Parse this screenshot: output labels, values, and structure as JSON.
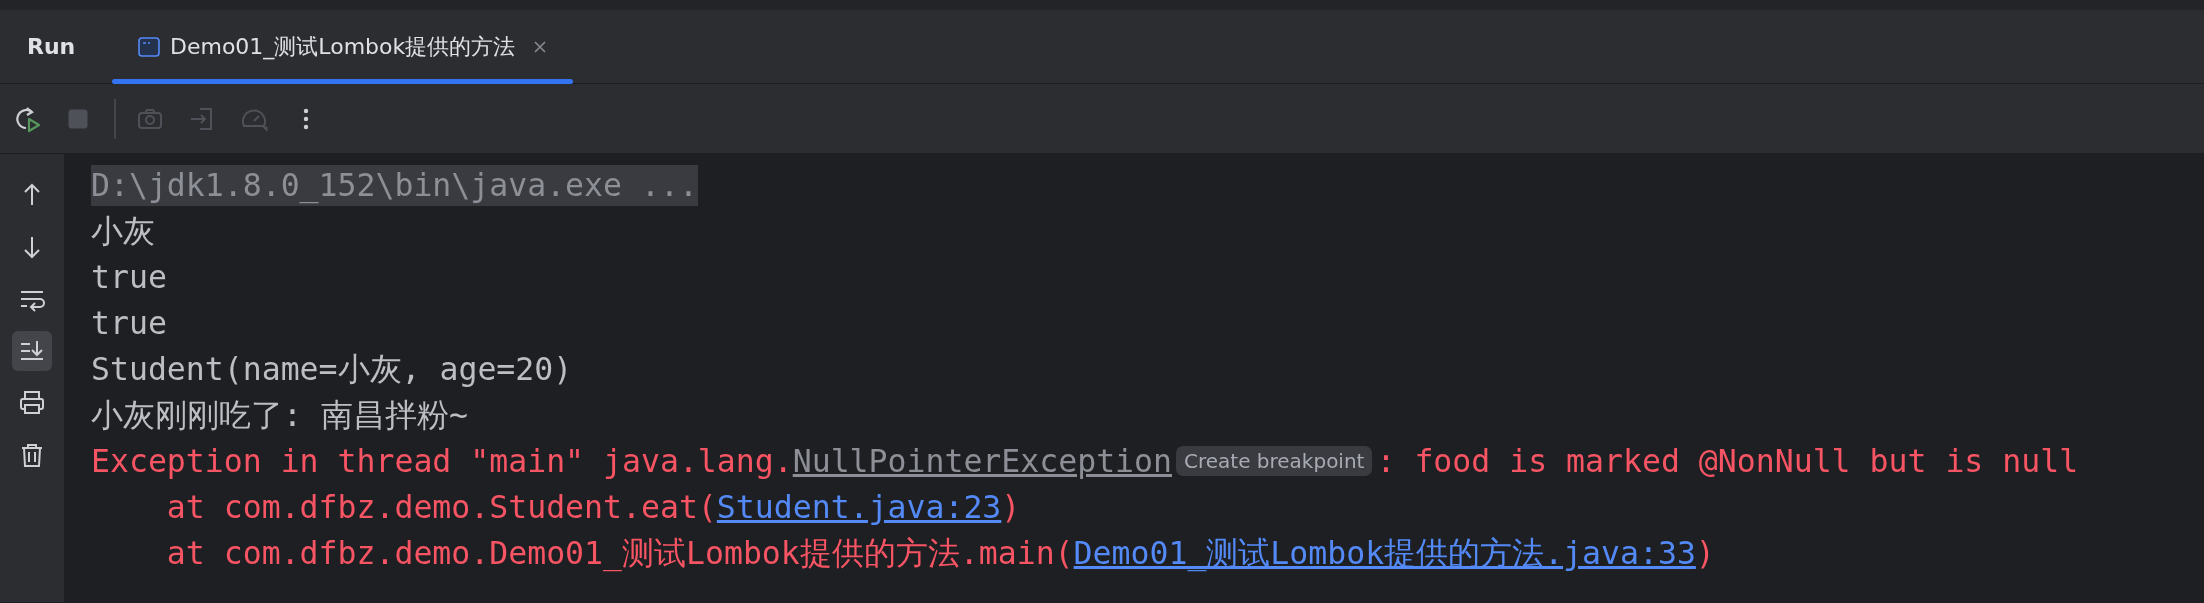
{
  "tool_window": {
    "title": "Run"
  },
  "tabs": [
    {
      "label": "Demo01_测试Lombok提供的方法",
      "selected": true,
      "closable": true
    }
  ],
  "toolbar": {
    "primary": [
      {
        "kind": "rerun",
        "disabled": false
      },
      {
        "kind": "stop",
        "disabled": true
      }
    ],
    "secondary": [
      {
        "kind": "screenshot",
        "disabled": true
      },
      {
        "kind": "attach",
        "disabled": true
      },
      {
        "kind": "profiler",
        "disabled": true
      },
      {
        "kind": "more",
        "disabled": false
      }
    ]
  },
  "gutter": [
    {
      "kind": "up",
      "selected": false
    },
    {
      "kind": "down",
      "selected": false
    },
    {
      "kind": "soft-wrap",
      "selected": false
    },
    {
      "kind": "scroll-end",
      "selected": true
    },
    {
      "kind": "print",
      "selected": false
    },
    {
      "kind": "clear",
      "selected": false
    }
  ],
  "console": [
    {
      "kind": "system",
      "segments": [
        {
          "kind": "text",
          "text": "D:\\jdk1.8.0_152\\bin\\java.exe ..."
        }
      ]
    },
    {
      "kind": "out",
      "segments": [
        {
          "kind": "text",
          "text": "小灰"
        }
      ]
    },
    {
      "kind": "out",
      "segments": [
        {
          "kind": "text",
          "text": "true"
        }
      ]
    },
    {
      "kind": "out",
      "segments": [
        {
          "kind": "text",
          "text": "true"
        }
      ]
    },
    {
      "kind": "out",
      "segments": [
        {
          "kind": "text",
          "text": "Student(name=小灰, age=20)"
        }
      ]
    },
    {
      "kind": "out",
      "segments": [
        {
          "kind": "text",
          "text": "小灰刚刚吃了: 南昌拌粉~"
        }
      ]
    },
    {
      "kind": "err",
      "segments": [
        {
          "kind": "text",
          "text": "Exception in thread \"main\" java.lang."
        },
        {
          "kind": "class-link",
          "text": "NullPointerException"
        },
        {
          "kind": "hint",
          "text": "Create breakpoint"
        },
        {
          "kind": "text",
          "text": ": food is marked @NonNull but is null"
        }
      ]
    },
    {
      "kind": "err",
      "segments": [
        {
          "kind": "text",
          "text": "    at com.dfbz.demo.Student.eat("
        },
        {
          "kind": "link",
          "text": "Student.java:23"
        },
        {
          "kind": "text",
          "text": ")"
        }
      ]
    },
    {
      "kind": "err",
      "segments": [
        {
          "kind": "text",
          "text": "    at com.dfbz.demo.Demo01_测试Lombok提供的方法.main("
        },
        {
          "kind": "link",
          "text": "Demo01_测试Lombok提供的方法.java:33"
        },
        {
          "kind": "text",
          "text": ")"
        }
      ]
    }
  ]
}
